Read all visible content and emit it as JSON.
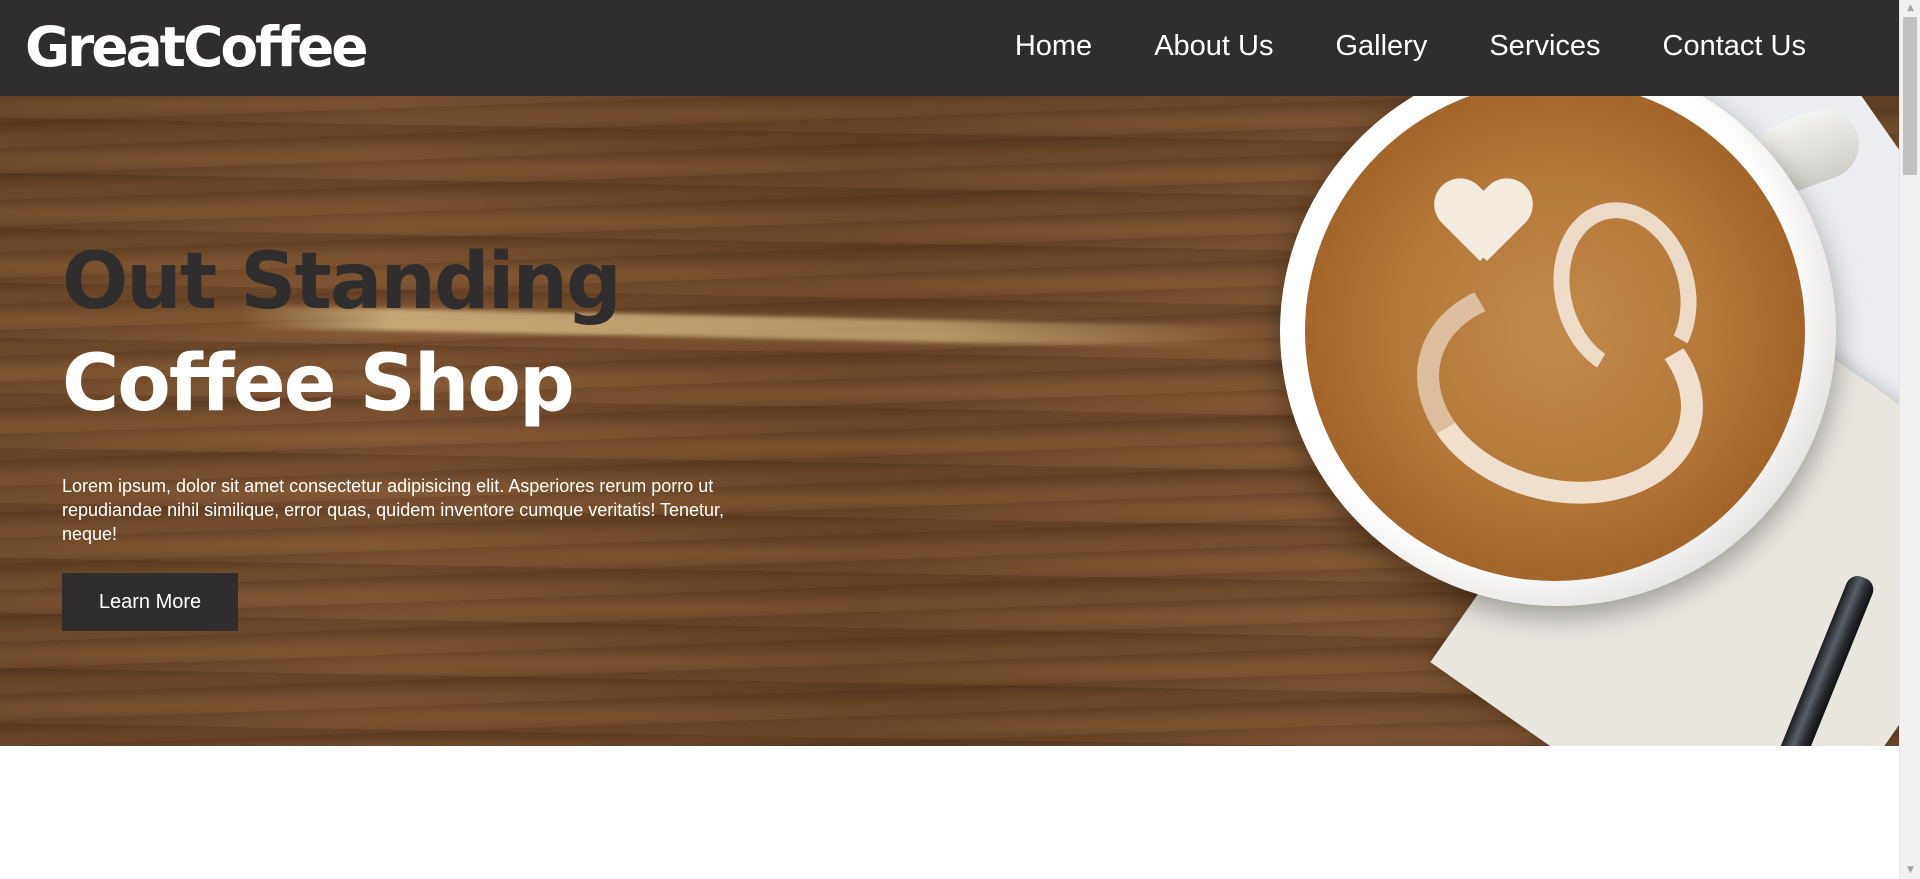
{
  "brand": {
    "logo": "GreatCoffee"
  },
  "nav": {
    "items": [
      {
        "label": "Home"
      },
      {
        "label": "About Us"
      },
      {
        "label": "Gallery"
      },
      {
        "label": "Services"
      },
      {
        "label": "Contact Us"
      }
    ]
  },
  "hero": {
    "headline_line1": "Out Standing",
    "headline_line2": "Coffee Shop",
    "description": "Lorem ipsum, dolor sit amet consectetur adipisicing elit. Asperiores rerum porro ut repudiandae nihil similique, error quas, quidem inventore cumque veritatis! Tenetur, neque!",
    "cta_label": "Learn More",
    "background_image": "coffee-cup-on-wooden-table"
  },
  "scrollbar": {
    "up_glyph": "▲",
    "down_glyph": "▼"
  },
  "colors": {
    "header_bg": "#302d2e",
    "headline_dark": "#302d2e",
    "button_bg": "#302d2e",
    "text_light": "#ffffff"
  }
}
